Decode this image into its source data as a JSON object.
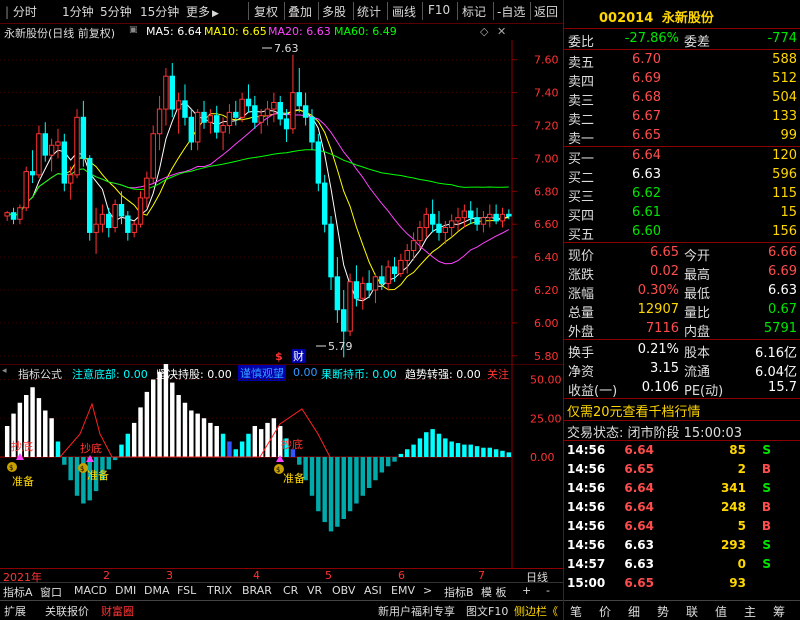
{
  "toolbar": {
    "left_items": [
      "分时",
      "1分钟",
      "5分钟",
      "15分钟",
      "更多"
    ],
    "right_items": [
      "复权",
      "叠加",
      "多股",
      "统计",
      "画线",
      "F10",
      "标记",
      "-自选",
      "返回"
    ]
  },
  "chart": {
    "stock_name_label": "永新股份(日线 前复权)",
    "ma5": "MA5: 6.64",
    "ma10": "MA10: 6.65",
    "ma20": "MA20: 6.63",
    "ma60": "MA60: 6.49",
    "high_label": "7.63",
    "low_label": "5.79",
    "price_axis": [
      "7.60",
      "7.40",
      "7.20",
      "7.00",
      "6.80",
      "6.60",
      "6.40",
      "6.20",
      "6.00",
      "5.80"
    ],
    "marker_s": "$",
    "marker_cai": "财",
    "colors": {
      "ma5": "#ffffff",
      "ma10": "#ffff00",
      "ma20": "#ff44ff",
      "ma60": "#00ff00",
      "up": "#ff3333",
      "down": "#00ffff"
    }
  },
  "indicator": {
    "name": "指标公式",
    "items": [
      {
        "label": "注意底部: 0.00",
        "color": "#00ffff"
      },
      {
        "label": "坚决持股: 0.00",
        "color": "#ffffff"
      },
      {
        "label": "谨慎观望",
        "color": "#3366ff",
        "bg": "#0000aa"
      },
      {
        "label": "0.00",
        "color": "#3399ff"
      },
      {
        "label": "果断持币: 0.00",
        "color": "#00ffff"
      },
      {
        "label": "趋势转强: 0.00",
        "color": "#ffffff"
      }
    ],
    "follow": "关注",
    "axis": [
      "50.00",
      "25.00",
      "0.00"
    ],
    "tags": {
      "chaodi1": "抄底",
      "chaodi2": "抄底",
      "chaodi3": "抄底",
      "zhunbei1": "准备",
      "zhunbei2": "准备",
      "zhunbei3": "准备"
    }
  },
  "date_axis": {
    "year": "2021年",
    "months": [
      "2",
      "3",
      "4",
      "5",
      "6",
      "7"
    ],
    "mode": "日线"
  },
  "tabs": [
    "指标A",
    "窗口",
    "MACD",
    "DMI",
    "DMA",
    "FSL",
    "TRIX",
    "BRAR",
    "CR",
    "VR",
    "OBV",
    "ASI",
    "EMV",
    ">",
    "指标B",
    "模 板",
    "+",
    "-"
  ],
  "bottom": {
    "left": [
      "扩展",
      "关联报价",
      "财富圈"
    ],
    "right": [
      "新用户福利专享",
      "图文F10",
      "侧边栏《"
    ]
  },
  "quote": {
    "code": "002014",
    "name": "永新股份",
    "weibi_label": "委比",
    "weibi_value": "-27.86%",
    "weicha_label": "委差",
    "weicha_value": "-774",
    "sell": [
      {
        "label": "卖五",
        "price": "6.70",
        "vol": "588"
      },
      {
        "label": "卖四",
        "price": "6.69",
        "vol": "512"
      },
      {
        "label": "卖三",
        "price": "6.68",
        "vol": "504"
      },
      {
        "label": "卖二",
        "price": "6.67",
        "vol": "133"
      },
      {
        "label": "卖一",
        "price": "6.65",
        "vol": "99"
      }
    ],
    "buy": [
      {
        "label": "买一",
        "price": "6.64",
        "vol": "120",
        "color": "red"
      },
      {
        "label": "买二",
        "price": "6.63",
        "vol": "596",
        "color": "white"
      },
      {
        "label": "买三",
        "price": "6.62",
        "vol": "115",
        "color": "green"
      },
      {
        "label": "买四",
        "price": "6.61",
        "vol": "15",
        "color": "green"
      },
      {
        "label": "买五",
        "price": "6.60",
        "vol": "156",
        "color": "green"
      }
    ],
    "stats": [
      {
        "l1": "现价",
        "v1": "6.65",
        "c1": "red",
        "l2": "今开",
        "v2": "6.66",
        "c2": "red"
      },
      {
        "l1": "涨跌",
        "v1": "0.02",
        "c1": "red",
        "l2": "最高",
        "v2": "6.69",
        "c2": "red"
      },
      {
        "l1": "涨幅",
        "v1": "0.30%",
        "c1": "red",
        "l2": "最低",
        "v2": "6.63",
        "c2": "white"
      },
      {
        "l1": "总量",
        "v1": "12907",
        "c1": "yellow",
        "l2": "量比",
        "v2": "0.67",
        "c2": "green"
      },
      {
        "l1": "外盘",
        "v1": "7116",
        "c1": "red",
        "l2": "内盘",
        "v2": "5791",
        "c2": "green"
      }
    ],
    "stats2": [
      {
        "l1": "换手",
        "v1": "0.21%",
        "l2": "股本",
        "v2": "6.16亿"
      },
      {
        "l1": "净资",
        "v1": "3.15",
        "l2": "流通",
        "v2": "6.04亿"
      },
      {
        "l1": "收益(一)",
        "v1": "0.106",
        "l2": "PE(动)",
        "v2": "15.7"
      }
    ],
    "promo": "仅需20元查看千档行情",
    "status_label": "交易状态: 闭市阶段 15:00:03",
    "trades": [
      {
        "t": "14:56",
        "p": "6.64",
        "pc": "red",
        "v": "85",
        "s": "S",
        "sc": "green"
      },
      {
        "t": "14:56",
        "p": "6.65",
        "pc": "red",
        "v": "2",
        "s": "B",
        "sc": "red"
      },
      {
        "t": "14:56",
        "p": "6.64",
        "pc": "red",
        "v": "341",
        "s": "S",
        "sc": "green"
      },
      {
        "t": "14:56",
        "p": "6.64",
        "pc": "red",
        "v": "248",
        "s": "B",
        "sc": "red"
      },
      {
        "t": "14:56",
        "p": "6.64",
        "pc": "red",
        "v": "5",
        "s": "B",
        "sc": "red"
      },
      {
        "t": "14:56",
        "p": "6.63",
        "pc": "white",
        "v": "293",
        "s": "S",
        "sc": "green"
      },
      {
        "t": "14:57",
        "p": "6.63",
        "pc": "white",
        "v": "0",
        "s": "S",
        "sc": "green"
      },
      {
        "t": "15:00",
        "p": "6.65",
        "pc": "red",
        "v": "93",
        "s": "",
        "sc": "green"
      }
    ],
    "bottom_tabs": [
      "笔",
      "价",
      "细",
      "势",
      "联",
      "值",
      "主",
      "筹"
    ]
  },
  "chart_data": {
    "type": "candlestick",
    "y_range": [
      5.75,
      7.72
    ],
    "candles": [
      [
        6.65,
        6.68,
        6.62,
        6.67
      ],
      [
        6.67,
        6.7,
        6.6,
        6.63
      ],
      [
        6.63,
        6.72,
        6.6,
        6.7
      ],
      [
        6.7,
        6.95,
        6.68,
        6.92
      ],
      [
        6.92,
        7.05,
        6.85,
        6.9
      ],
      [
        6.9,
        7.2,
        6.88,
        7.15
      ],
      [
        7.15,
        7.22,
        6.98,
        7.02
      ],
      [
        7.02,
        7.12,
        6.92,
        7.08
      ],
      [
        7.08,
        7.18,
        7.0,
        7.1
      ],
      [
        7.1,
        7.15,
        6.8,
        6.85
      ],
      [
        6.85,
        6.95,
        6.75,
        6.9
      ],
      [
        6.9,
        7.3,
        6.88,
        7.25
      ],
      [
        7.25,
        7.35,
        6.95,
        7.0
      ],
      [
        7.0,
        7.02,
        6.5,
        6.55
      ],
      [
        6.55,
        6.7,
        6.42,
        6.6
      ],
      [
        6.6,
        6.72,
        6.55,
        6.66
      ],
      [
        6.66,
        6.7,
        6.52,
        6.58
      ],
      [
        6.58,
        6.75,
        6.55,
        6.72
      ],
      [
        6.72,
        6.8,
        6.6,
        6.65
      ],
      [
        6.65,
        6.68,
        6.5,
        6.55
      ],
      [
        6.55,
        6.62,
        6.52,
        6.6
      ],
      [
        6.6,
        6.8,
        6.58,
        6.76
      ],
      [
        6.76,
        6.92,
        6.7,
        6.88
      ],
      [
        6.88,
        7.2,
        6.85,
        7.15
      ],
      [
        7.15,
        7.38,
        7.05,
        7.3
      ],
      [
        7.3,
        7.55,
        7.2,
        7.5
      ],
      [
        7.5,
        7.58,
        7.25,
        7.3
      ],
      [
        7.3,
        7.4,
        7.15,
        7.35
      ],
      [
        7.35,
        7.45,
        7.2,
        7.25
      ],
      [
        7.25,
        7.3,
        7.05,
        7.1
      ],
      [
        7.1,
        7.3,
        7.05,
        7.28
      ],
      [
        7.28,
        7.35,
        7.18,
        7.22
      ],
      [
        7.22,
        7.3,
        7.15,
        7.26
      ],
      [
        7.26,
        7.32,
        7.12,
        7.16
      ],
      [
        7.16,
        7.25,
        7.05,
        7.2
      ],
      [
        7.2,
        7.33,
        7.15,
        7.28
      ],
      [
        7.28,
        7.35,
        7.2,
        7.25
      ],
      [
        7.25,
        7.4,
        7.22,
        7.36
      ],
      [
        7.36,
        7.45,
        7.28,
        7.32
      ],
      [
        7.32,
        7.38,
        7.18,
        7.22
      ],
      [
        7.22,
        7.3,
        7.15,
        7.26
      ],
      [
        7.26,
        7.35,
        7.2,
        7.3
      ],
      [
        7.3,
        7.4,
        7.22,
        7.34
      ],
      [
        7.34,
        7.38,
        7.2,
        7.24
      ],
      [
        7.24,
        7.3,
        7.1,
        7.18
      ],
      [
        7.18,
        7.63,
        7.15,
        7.4
      ],
      [
        7.4,
        7.55,
        7.28,
        7.32
      ],
      [
        7.32,
        7.4,
        7.2,
        7.25
      ],
      [
        7.25,
        7.3,
        7.05,
        7.1
      ],
      [
        7.1,
        7.15,
        6.8,
        6.85
      ],
      [
        6.85,
        6.9,
        6.55,
        6.6
      ],
      [
        6.6,
        6.65,
        6.2,
        6.28
      ],
      [
        6.28,
        6.4,
        6.0,
        6.08
      ],
      [
        6.08,
        6.2,
        5.79,
        5.95
      ],
      [
        5.95,
        6.3,
        5.92,
        6.25
      ],
      [
        6.25,
        6.35,
        6.1,
        6.15
      ],
      [
        6.15,
        6.28,
        6.08,
        6.24
      ],
      [
        6.24,
        6.32,
        6.15,
        6.2
      ],
      [
        6.2,
        6.3,
        6.12,
        6.28
      ],
      [
        6.28,
        6.35,
        6.2,
        6.24
      ],
      [
        6.24,
        6.38,
        6.2,
        6.34
      ],
      [
        6.34,
        6.4,
        6.25,
        6.3
      ],
      [
        6.3,
        6.42,
        6.28,
        6.38
      ],
      [
        6.38,
        6.48,
        6.3,
        6.44
      ],
      [
        6.44,
        6.55,
        6.38,
        6.5
      ],
      [
        6.5,
        6.62,
        6.45,
        6.58
      ],
      [
        6.58,
        6.7,
        6.52,
        6.66
      ],
      [
        6.66,
        6.75,
        6.55,
        6.6
      ],
      [
        6.6,
        6.68,
        6.5,
        6.55
      ],
      [
        6.55,
        6.62,
        6.48,
        6.58
      ],
      [
        6.58,
        6.66,
        6.52,
        6.62
      ],
      [
        6.62,
        6.7,
        6.56,
        6.64
      ],
      [
        6.64,
        6.72,
        6.58,
        6.68
      ],
      [
        6.68,
        6.74,
        6.6,
        6.64
      ],
      [
        6.64,
        6.7,
        6.56,
        6.6
      ],
      [
        6.6,
        6.68,
        6.55,
        6.64
      ],
      [
        6.64,
        6.72,
        6.58,
        6.66
      ],
      [
        6.66,
        6.72,
        6.6,
        6.62
      ],
      [
        6.62,
        6.7,
        6.58,
        6.66
      ],
      [
        6.66,
        6.69,
        6.63,
        6.65
      ]
    ],
    "indicator_values": [
      20,
      28,
      35,
      40,
      45,
      38,
      30,
      25,
      10,
      -5,
      -15,
      -25,
      -30,
      -28,
      -22,
      -15,
      -8,
      -2,
      8,
      15,
      22,
      32,
      42,
      50,
      55,
      60,
      48,
      40,
      35,
      30,
      28,
      25,
      22,
      20,
      15,
      10,
      5,
      10,
      15,
      20,
      18,
      22,
      25,
      20,
      12,
      5,
      -5,
      -15,
      -25,
      -35,
      -42,
      -48,
      -45,
      -40,
      -35,
      -30,
      -25,
      -20,
      -15,
      -10,
      -6,
      -3,
      2,
      5,
      8,
      12,
      16,
      18,
      15,
      12,
      10,
      9,
      8,
      8,
      7,
      6,
      6,
      5,
      4,
      3
    ]
  }
}
